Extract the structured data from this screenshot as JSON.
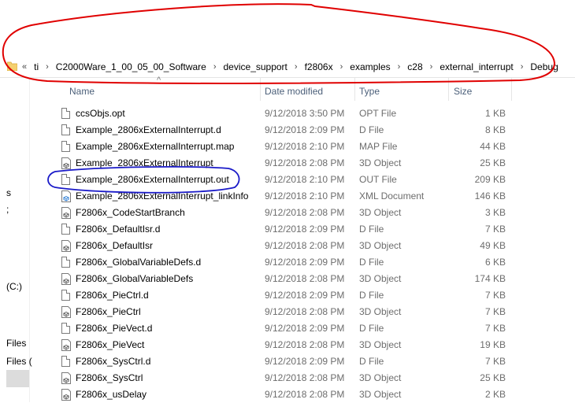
{
  "address_bar": {
    "overflow": "«",
    "crumbs": [
      "ti",
      "C2000Ware_1_00_05_00_Software",
      "device_support",
      "f2806x",
      "examples",
      "c28",
      "external_interrupt",
      "Debug"
    ],
    "separator": "›"
  },
  "nav": {
    "items": [
      "s",
      ";",
      "(C:)",
      "Files",
      "Files ("
    ]
  },
  "columns": {
    "name": "Name",
    "date": "Date modified",
    "type": "Type",
    "size": "Size"
  },
  "files": [
    {
      "name": "ccsObjs.opt",
      "date": "9/12/2018 3:50 PM",
      "type": "OPT File",
      "size": "1 KB",
      "icon": "document-icon"
    },
    {
      "name": "Example_2806xExternalInterrupt.d",
      "date": "9/12/2018 2:09 PM",
      "type": "D File",
      "size": "8 KB",
      "icon": "document-icon"
    },
    {
      "name": "Example_2806xExternalInterrupt.map",
      "date": "9/12/2018 2:10 PM",
      "type": "MAP File",
      "size": "44 KB",
      "icon": "document-icon"
    },
    {
      "name": "Example_2806xExternalInterrupt",
      "date": "9/12/2018 2:08 PM",
      "type": "3D Object",
      "size": "25 KB",
      "icon": "3d-object-icon"
    },
    {
      "name": "Example_2806xExternalInterrupt.out",
      "date": "9/12/2018 2:10 PM",
      "type": "OUT File",
      "size": "209 KB",
      "icon": "document-icon"
    },
    {
      "name": "Example_2806xExternalInterrupt_linkInfo",
      "date": "9/12/2018 2:10 PM",
      "type": "XML Document",
      "size": "146 KB",
      "icon": "xml-document-icon"
    },
    {
      "name": "F2806x_CodeStartBranch",
      "date": "9/12/2018 2:08 PM",
      "type": "3D Object",
      "size": "3 KB",
      "icon": "3d-object-icon"
    },
    {
      "name": "F2806x_DefaultIsr.d",
      "date": "9/12/2018 2:09 PM",
      "type": "D File",
      "size": "7 KB",
      "icon": "document-icon"
    },
    {
      "name": "F2806x_DefaultIsr",
      "date": "9/12/2018 2:08 PM",
      "type": "3D Object",
      "size": "49 KB",
      "icon": "3d-object-icon"
    },
    {
      "name": "F2806x_GlobalVariableDefs.d",
      "date": "9/12/2018 2:09 PM",
      "type": "D File",
      "size": "6 KB",
      "icon": "document-icon"
    },
    {
      "name": "F2806x_GlobalVariableDefs",
      "date": "9/12/2018 2:08 PM",
      "type": "3D Object",
      "size": "174 KB",
      "icon": "3d-object-icon"
    },
    {
      "name": "F2806x_PieCtrl.d",
      "date": "9/12/2018 2:09 PM",
      "type": "D File",
      "size": "7 KB",
      "icon": "document-icon"
    },
    {
      "name": "F2806x_PieCtrl",
      "date": "9/12/2018 2:08 PM",
      "type": "3D Object",
      "size": "7 KB",
      "icon": "3d-object-icon"
    },
    {
      "name": "F2806x_PieVect.d",
      "date": "9/12/2018 2:09 PM",
      "type": "D File",
      "size": "7 KB",
      "icon": "document-icon"
    },
    {
      "name": "F2806x_PieVect",
      "date": "9/12/2018 2:08 PM",
      "type": "3D Object",
      "size": "19 KB",
      "icon": "3d-object-icon"
    },
    {
      "name": "F2806x_SysCtrl.d",
      "date": "9/12/2018 2:09 PM",
      "type": "D File",
      "size": "7 KB",
      "icon": "document-icon"
    },
    {
      "name": "F2806x_SysCtrl",
      "date": "9/12/2018 2:08 PM",
      "type": "3D Object",
      "size": "25 KB",
      "icon": "3d-object-icon"
    },
    {
      "name": "F2806x_usDelay",
      "date": "9/12/2018 2:08 PM",
      "type": "3D Object",
      "size": "2 KB",
      "icon": "3d-object-icon"
    }
  ],
  "annotations": {
    "address_circle_color": "#e00000",
    "file_circle_color": "#1a1ac8"
  }
}
